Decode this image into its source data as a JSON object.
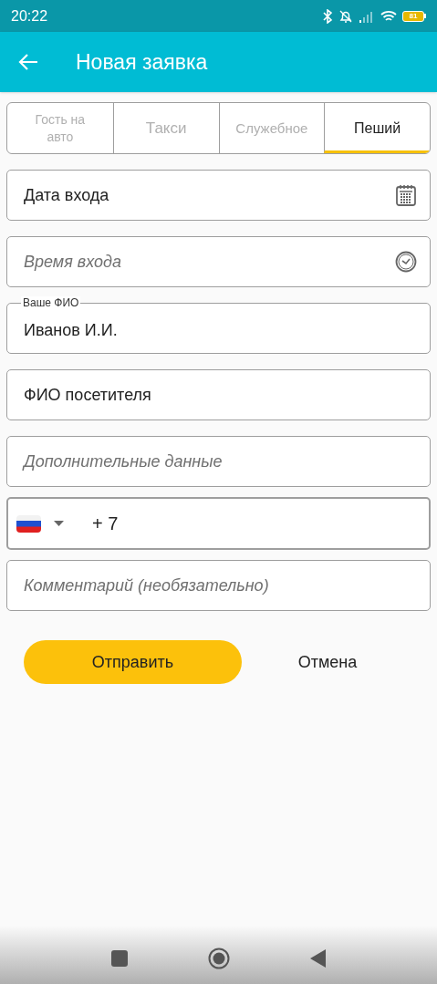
{
  "status_bar": {
    "time": "20:22",
    "battery": "81"
  },
  "app_bar": {
    "title": "Новая заявка"
  },
  "tabs": [
    {
      "label": "Гость на авто",
      "selected": false
    },
    {
      "label": "Такси",
      "selected": false
    },
    {
      "label": "Служебное",
      "selected": false
    },
    {
      "label": "Пеший",
      "selected": true
    }
  ],
  "fields": [
    {
      "kind": "date",
      "label": "Дата входа"
    },
    {
      "kind": "time",
      "placeholder": "Время входа"
    },
    {
      "kind": "text",
      "label": "Ваше ФИО",
      "value": "Иванов И.И."
    },
    {
      "kind": "text",
      "label": "ФИО посетителя"
    },
    {
      "kind": "text",
      "placeholder": "Дополнительные данные"
    },
    {
      "kind": "phone",
      "value": "+ 7"
    },
    {
      "kind": "text",
      "placeholder": "Комментарий (необязательно)"
    }
  ],
  "buttons": [
    {
      "kind": "primary",
      "label": "Отправить"
    },
    {
      "kind": "text",
      "label": "Отмена"
    }
  ]
}
